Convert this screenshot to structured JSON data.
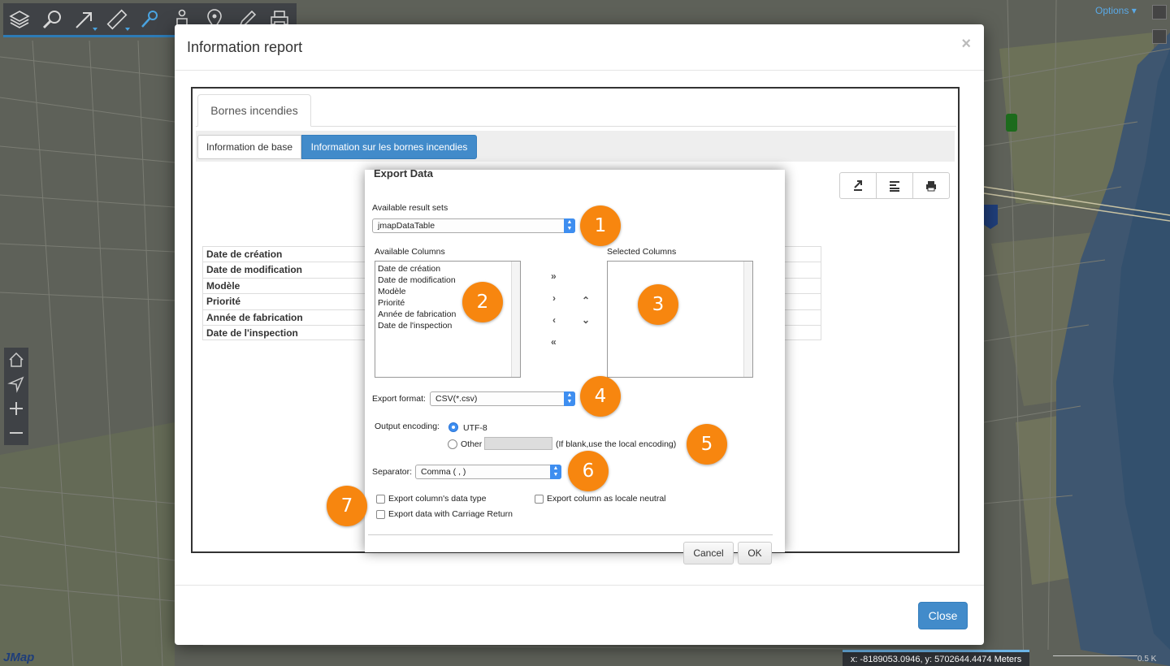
{
  "map": {
    "options_label": "Options",
    "logo": "JMap",
    "coords": "x: -8189053.0946, y: 5702644.4474 Meters",
    "scale_text": "0.5 K"
  },
  "toolbar": {
    "tools": [
      "layers-icon",
      "search-icon",
      "select-arrow-icon",
      "measure-ruler-icon",
      "info-pin-icon",
      "person-icon",
      "location-pin-icon",
      "edit-tool-icon",
      "print-icon"
    ]
  },
  "modal": {
    "title": "Information report",
    "close_symbol": "×",
    "close_button": "Close",
    "tab_main": "Bornes incendies",
    "subtabs": [
      "Information de base",
      "Information sur les bornes incendies"
    ],
    "attributes": [
      "Date de création",
      "Date de modification",
      "Modèle",
      "Priorité",
      "Année de fabrication",
      "Date de l'inspection"
    ]
  },
  "export": {
    "title": "Export Data",
    "result_sets_label": "Available result sets",
    "result_set_value": "jmapDataTable",
    "available_columns_label": "Available Columns",
    "selected_columns_label": "Selected Columns",
    "available_columns": [
      "Date de création",
      "Date de modification",
      "Modèle",
      "Priorité",
      "Année de fabrication",
      "Date de l'inspection"
    ],
    "move_buttons": [
      "»",
      "›",
      "‹",
      "«"
    ],
    "order_buttons": [
      "⌃",
      "⌄"
    ],
    "format_label": "Export format:",
    "format_value": "CSV(*.csv)",
    "encoding_label": "Output encoding:",
    "encoding_utf8": "UTF-8",
    "encoding_other": "Other",
    "encoding_hint": "(If blank,use the local encoding)",
    "separator_label": "Separator:",
    "separator_value": "Comma ( , )",
    "opt_data_type": "Export column's data type",
    "opt_locale": "Export column as locale neutral",
    "opt_carriage": "Export data with Carriage Return",
    "cancel": "Cancel",
    "ok": "OK"
  },
  "badges": [
    "1",
    "2",
    "3",
    "4",
    "5",
    "6",
    "7"
  ],
  "colors": {
    "accent": "#428bca",
    "badge": "#f7860f",
    "toolbar": "#3f4246"
  }
}
